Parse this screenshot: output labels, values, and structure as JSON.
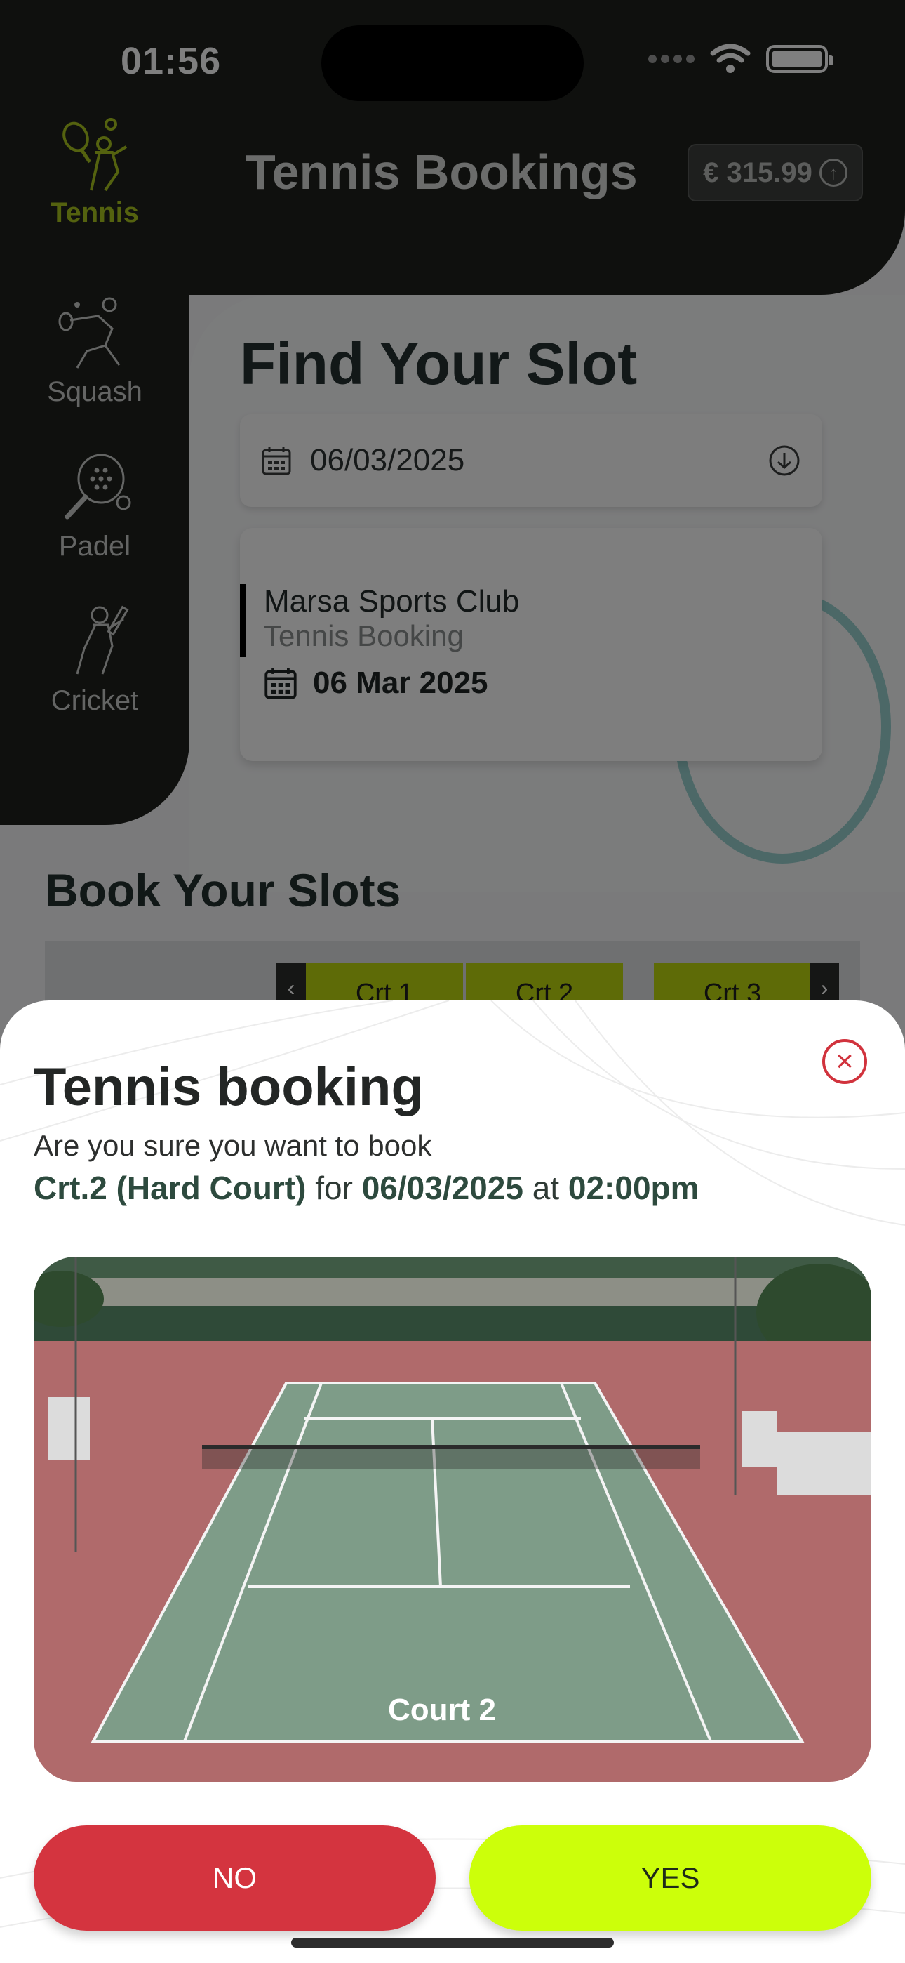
{
  "status_bar": {
    "time": "01:56"
  },
  "header": {
    "title": "Tennis Bookings",
    "wallet_amount": "€ 315.99"
  },
  "sidebar": {
    "items": [
      {
        "label": "Tennis",
        "active": true
      },
      {
        "label": "Squash",
        "active": false
      },
      {
        "label": "Padel",
        "active": false
      },
      {
        "label": "Cricket",
        "active": false
      }
    ]
  },
  "find_slot": {
    "title": "Find Your Slot",
    "date_value": "06/03/2025",
    "club_name": "Marsa Sports Club",
    "club_sub": "Tennis Booking",
    "club_date": "06 Mar 2025"
  },
  "book_slots": {
    "title": "Book Your Slots",
    "courts": [
      "Crt 1",
      "Crt 2",
      "Crt 3"
    ]
  },
  "modal": {
    "title": "Tennis booking",
    "question": "Are you sure you want to book",
    "court": "Crt.2 (Hard Court)",
    "for_text": "for",
    "date": "06/03/2025",
    "at_text": "at",
    "time": "02:00pm",
    "photo_label": "Court 2",
    "no_label": "NO",
    "yes_label": "YES"
  },
  "colors": {
    "accent_lime": "#ccff0a",
    "danger_red": "#d4343f",
    "dark_bg": "#1e201d",
    "sidebar_active": "#a8c41f"
  }
}
